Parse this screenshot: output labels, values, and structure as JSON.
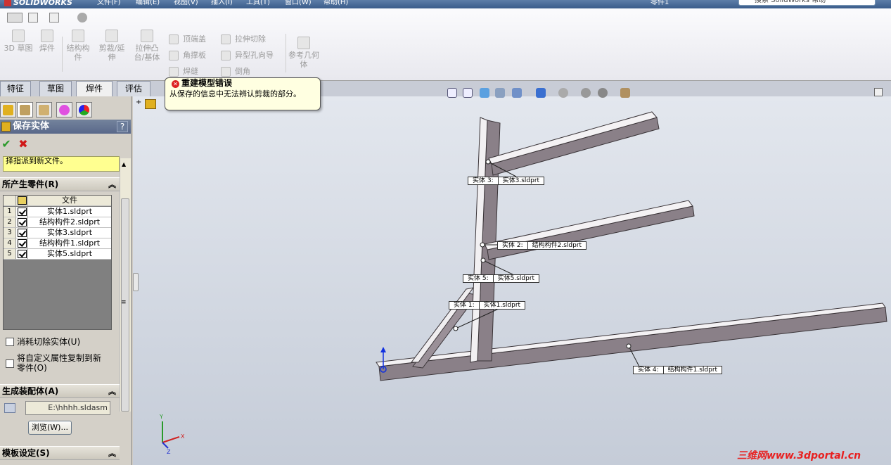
{
  "app": {
    "brand": "SOLIDWORKS",
    "doc_name": "零件1",
    "search_placeholder": "搜索 SolidWorks 帮助"
  },
  "menu": [
    "文件(F)",
    "编辑(E)",
    "视图(V)",
    "插入(I)",
    "工具(T)",
    "窗口(W)",
    "帮助(H)"
  ],
  "command_manager": {
    "big_buttons": [
      "3D 草图",
      "焊件",
      "结构构件",
      "剪裁/延伸",
      "拉伸凸台/基体"
    ],
    "small_buttons_col1": [
      "顶端盖",
      "角撑板",
      "焊缝"
    ],
    "small_buttons_col2": [
      "拉伸切除",
      "异型孔向导",
      "倒角"
    ],
    "ref_geom": "参考几何体"
  },
  "tabs": [
    "特征",
    "草图",
    "焊件",
    "评估"
  ],
  "active_tab": "焊件",
  "error_tooltip": {
    "title": "重建模型错误",
    "body": "从保存的信息中无法辨认剪裁的部分。"
  },
  "property_manager": {
    "title": "保存实体",
    "help": "?",
    "message": "择指派到新文件。",
    "section_parts": "所产生零件(R)",
    "table_header": "文件",
    "rows": [
      {
        "num": "1",
        "name": "实体1.sldprt"
      },
      {
        "num": "2",
        "name": "结构构件2.sldprt"
      },
      {
        "num": "3",
        "name": "实体3.sldprt"
      },
      {
        "num": "4",
        "name": "结构构件1.sldprt"
      },
      {
        "num": "5",
        "name": "实体5.sldprt"
      }
    ],
    "consume_cut": "消耗切除实体(U)",
    "copy_props": "将自定义属性复制到新零件(O)",
    "section_asm": "生成装配体(A)",
    "asm_path": "E:\\hhhh.sldasm",
    "browse": "浏览(W)...",
    "section_template": "模板设定(S)"
  },
  "callouts": [
    {
      "a": "实体   3:",
      "b": "实体3.sldprt"
    },
    {
      "a": "实体   2:",
      "b": "结构构件2.sldprt"
    },
    {
      "a": "实体   5:",
      "b": "实体5.sldprt"
    },
    {
      "a": "实体   1:",
      "b": "实体1.sldprt"
    },
    {
      "a": "实体   4:",
      "b": "结构构件1.sldprt"
    }
  ],
  "triad": {
    "x": "X",
    "y": "Y",
    "z": "Z"
  },
  "watermark": "三维网www.3dportal.cn",
  "colors": {
    "beam": "#8a8088",
    "beam_top": "#f4f2f4",
    "viewport_top": "#e3e7ee",
    "viewport_bottom": "#c5ccd8",
    "pm_header": "#5f6e8f",
    "error": "#d22222"
  }
}
